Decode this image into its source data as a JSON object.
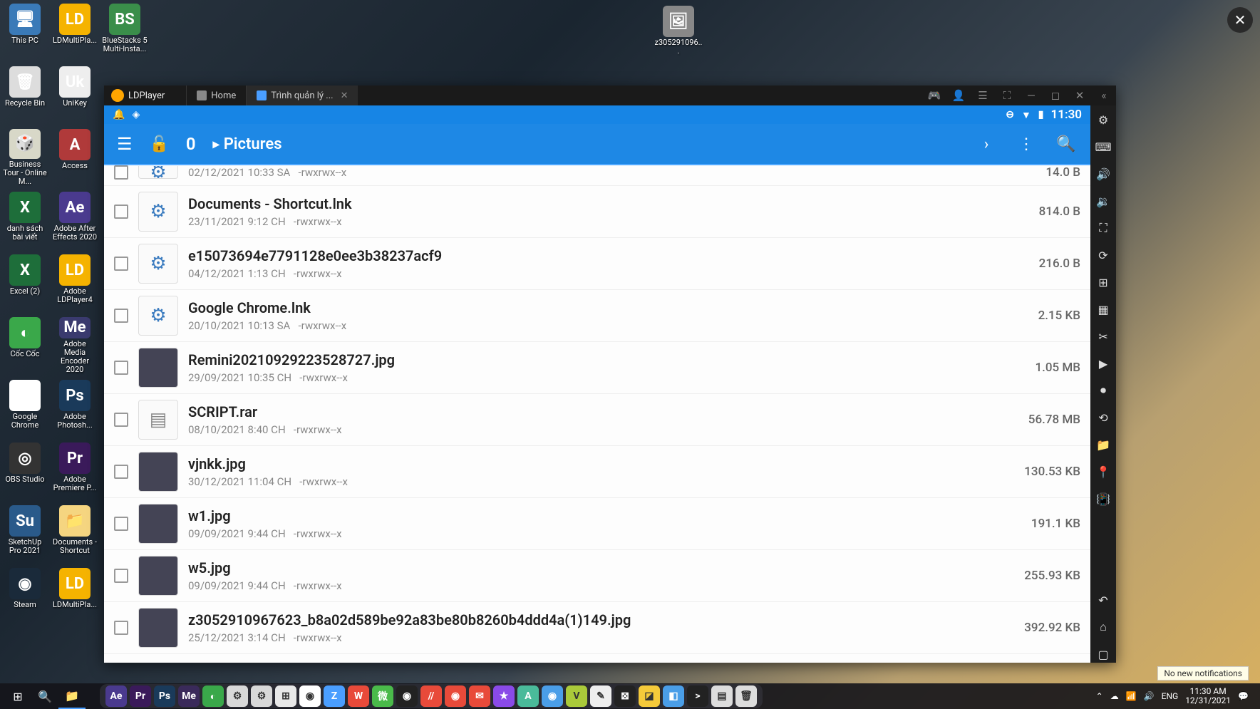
{
  "desktopIcons": {
    "rows": [
      [
        {
          "label": "This PC",
          "bg": "#3a7ab8",
          "txt": "🖥"
        },
        {
          "label": "LDMultiPla...",
          "bg": "#f5b300",
          "txt": "LD"
        },
        {
          "label": "BlueStacks 5 Multi-Insta...",
          "bg": "#3a8e4a",
          "txt": "BS"
        }
      ],
      [
        {
          "label": "Recycle Bin",
          "bg": "#ddd",
          "txt": "🗑"
        },
        {
          "label": "UniKey",
          "bg": "#eee",
          "txt": "Uk"
        }
      ],
      [
        {
          "label": "Business Tour - Online M...",
          "bg": "#d8d8c8",
          "txt": "🎲"
        },
        {
          "label": "Access",
          "bg": "#b03a3a",
          "txt": "A"
        }
      ],
      [
        {
          "label": "danh sách bài viết",
          "bg": "#1e6e3a",
          "txt": "X"
        },
        {
          "label": "Adobe After Effects 2020",
          "bg": "#4a3a8e",
          "txt": "Ae"
        }
      ],
      [
        {
          "label": "Excel (2)",
          "bg": "#1e6e3a",
          "txt": "X"
        },
        {
          "label": "Adobe LDPlayer4",
          "bg": "#f5b300",
          "txt": "LD"
        }
      ],
      [
        {
          "label": "Cốc Cốc",
          "bg": "#3aa84a",
          "txt": "◐"
        },
        {
          "label": "Adobe Media Encoder 2020",
          "bg": "#3a3a6e",
          "txt": "Me"
        }
      ],
      [
        {
          "label": "Google Chrome",
          "bg": "#fff",
          "txt": "◉"
        },
        {
          "label": "Adobe Photosh...",
          "bg": "#1a3a5a",
          "txt": "Ps"
        }
      ],
      [
        {
          "label": "OBS Studio",
          "bg": "#333",
          "txt": "◎"
        },
        {
          "label": "Adobe Premiere P...",
          "bg": "#3a1a5a",
          "txt": "Pr"
        }
      ],
      [
        {
          "label": "SketchUp Pro 2021",
          "bg": "#2a5a8a",
          "txt": "Su"
        },
        {
          "label": "Documents - Shortcut",
          "bg": "#f5d580",
          "txt": "📁"
        }
      ],
      [
        {
          "label": "Steam",
          "bg": "#1a2a3a",
          "txt": "◉"
        },
        {
          "label": "LDMultiPla...",
          "bg": "#f5b300",
          "txt": "LD"
        }
      ]
    ],
    "single": {
      "label": "z305291096...",
      "bg": "#888",
      "txt": "🖼"
    }
  },
  "ldplayer": {
    "name": "LDPlayer",
    "tabs": [
      {
        "label": "Home",
        "active": false,
        "iconClass": "home-icon"
      },
      {
        "label": "Trình quản lý ...",
        "active": true,
        "iconClass": ""
      }
    ]
  },
  "android": {
    "clock": "11:30"
  },
  "app": {
    "count": "0",
    "path": "Pictures"
  },
  "files": [
    {
      "name": "",
      "date": "02/12/2021 10:33 SA",
      "perm": "-rwxrwx--x",
      "size": "14.0 B",
      "thumb": "gear",
      "partial": true
    },
    {
      "name": "Documents - Shortcut.lnk",
      "date": "23/11/2021 9:12 CH",
      "perm": "-rwxrwx--x",
      "size": "814.0 B",
      "thumb": "gear"
    },
    {
      "name": "e15073694e7791128e0ee3b38237acf9",
      "date": "04/12/2021 1:13 CH",
      "perm": "-rwxrwx--x",
      "size": "216.0 B",
      "thumb": "gear"
    },
    {
      "name": "Google Chrome.lnk",
      "date": "20/10/2021 10:13 SA",
      "perm": "-rwxrwx--x",
      "size": "2.15 KB",
      "thumb": "gear"
    },
    {
      "name": "Remini20210929223528727.jpg",
      "date": "29/09/2021 10:35 CH",
      "perm": "-rwxrwx--x",
      "size": "1.05 MB",
      "thumb": "img"
    },
    {
      "name": "SCRIPT.rar",
      "date": "08/10/2021 8:40 CH",
      "perm": "-rwxrwx--x",
      "size": "56.78 MB",
      "thumb": "archive"
    },
    {
      "name": "vjnkk.jpg",
      "date": "30/12/2021 11:04 CH",
      "perm": "-rwxrwx--x",
      "size": "130.53 KB",
      "thumb": "img"
    },
    {
      "name": "w1.jpg",
      "date": "09/09/2021 9:44 CH",
      "perm": "-rwxrwx--x",
      "size": "191.1 KB",
      "thumb": "img"
    },
    {
      "name": "w5.jpg",
      "date": "09/09/2021 9:44 CH",
      "perm": "-rwxrwx--x",
      "size": "255.93 KB",
      "thumb": "img"
    },
    {
      "name": "z3052910967623_b8a02d589be92a83be80b8260b4ddd4a(1)149.jpg",
      "date": "25/12/2021 3:14 CH",
      "perm": "-rwxrwx--x",
      "size": "392.92 KB",
      "thumb": "img"
    }
  ],
  "taskbar": {
    "dock": [
      {
        "bg": "#4a3a8e",
        "txt": "Ae"
      },
      {
        "bg": "#3a1a5a",
        "txt": "Pr"
      },
      {
        "bg": "#1a3a5a",
        "txt": "Ps"
      },
      {
        "bg": "#3a2a5a",
        "txt": "Me"
      },
      {
        "bg": "#3aa84a",
        "txt": "◐"
      },
      {
        "bg": "#d8d8d8",
        "txt": "⚙"
      },
      {
        "bg": "#d8d8d8",
        "txt": "⚙"
      },
      {
        "bg": "#e8e8e8",
        "txt": "⊞"
      },
      {
        "bg": "#fff",
        "txt": "◉"
      },
      {
        "bg": "#4a9eff",
        "txt": "Z"
      },
      {
        "bg": "#e84a3a",
        "txt": "W"
      },
      {
        "bg": "#4aba4a",
        "txt": "微"
      },
      {
        "bg": "#222",
        "txt": "◉"
      },
      {
        "bg": "#e84a3a",
        "txt": "//"
      },
      {
        "bg": "#e84a3a",
        "txt": "◉"
      },
      {
        "bg": "#e84a3a",
        "txt": "✉"
      },
      {
        "bg": "#8a4ae8",
        "txt": "★"
      },
      {
        "bg": "#4aba9a",
        "txt": "A"
      },
      {
        "bg": "#4a9ee8",
        "txt": "◉"
      },
      {
        "bg": "#aaca3a",
        "txt": "V"
      },
      {
        "bg": "#eee",
        "txt": "✎"
      },
      {
        "bg": "#222",
        "txt": "⊠"
      },
      {
        "bg": "#f5ca3a",
        "txt": "◪"
      },
      {
        "bg": "#4a9ee8",
        "txt": "◧"
      },
      {
        "bg": "#222",
        "txt": ">"
      },
      {
        "bg": "#ddd",
        "txt": "▤"
      },
      {
        "bg": "#ddd",
        "txt": "🗑"
      }
    ],
    "lang": "ENG",
    "time": "11:30 AM",
    "date": "12/31/2021",
    "tooltip": "No new notifications"
  }
}
